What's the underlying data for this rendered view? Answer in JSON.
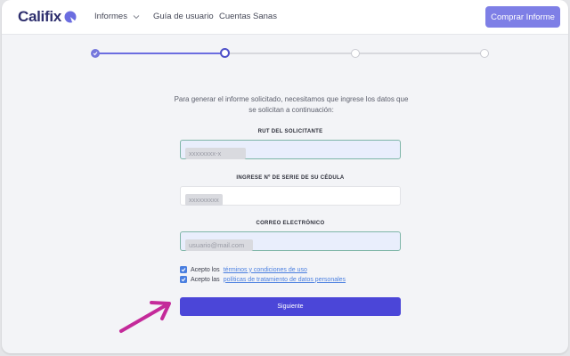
{
  "brand": {
    "name": "Califix"
  },
  "nav": {
    "items": [
      {
        "label": "Informes",
        "has_dropdown": true
      },
      {
        "label": "Guía de usuario"
      },
      {
        "label": "Cuentas Sanas"
      }
    ],
    "cta_label": "Comprar Informe"
  },
  "stepper": {
    "total_steps": 4,
    "current_step": 2,
    "completed_steps": 1
  },
  "form": {
    "intro": "Para generar el informe solicitado, necesitamos que ingrese los datos que se solicitan a continuación:",
    "fields": [
      {
        "label": "RUT DEL SOLICITANTE",
        "placeholder": "xxxxxxxx-x"
      },
      {
        "label": "INGRESE Nº DE SERIE DE SU CÉDULA",
        "placeholder": "xxxxxxxxx"
      },
      {
        "label": "CORREO ELECTRÓNICO",
        "placeholder": "usuario@mail.com"
      }
    ],
    "consents": [
      {
        "prefix": "Acepto los",
        "link": "términos y condiciones de uso",
        "checked": true
      },
      {
        "prefix": "Acepto las",
        "link": "políticas de tratamiento de datos personales",
        "checked": true
      }
    ],
    "submit_label": "Siguiente"
  },
  "colors": {
    "brand": "#2e2f6e",
    "accent": "#4b46d8",
    "cta": "#7e7fe6",
    "link": "#4a7fe0",
    "annotation_arrow": "#c42a9a"
  }
}
